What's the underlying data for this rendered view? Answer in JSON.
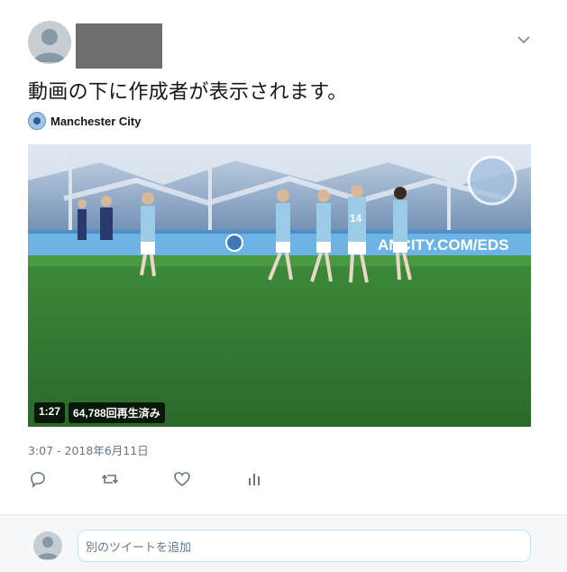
{
  "tweet": {
    "text": "動画の下に作成者が表示されます。",
    "author_name": "Manchester City",
    "timestamp": "3:07 - 2018年6月11日"
  },
  "video": {
    "duration": "1:27",
    "views": "64,788回再生済み",
    "board_text": "ANCITY.COM/EDS"
  },
  "reply": {
    "placeholder": "別のツイートを追加"
  },
  "icons": {
    "menu": "chevron-down-icon",
    "reply": "reply-icon",
    "retweet": "retweet-icon",
    "like": "heart-icon",
    "analytics": "analytics-icon"
  },
  "colors": {
    "secondary_text": "#657786",
    "reply_border": "#c6e1f5",
    "reply_bg": "#f5f8fa"
  }
}
